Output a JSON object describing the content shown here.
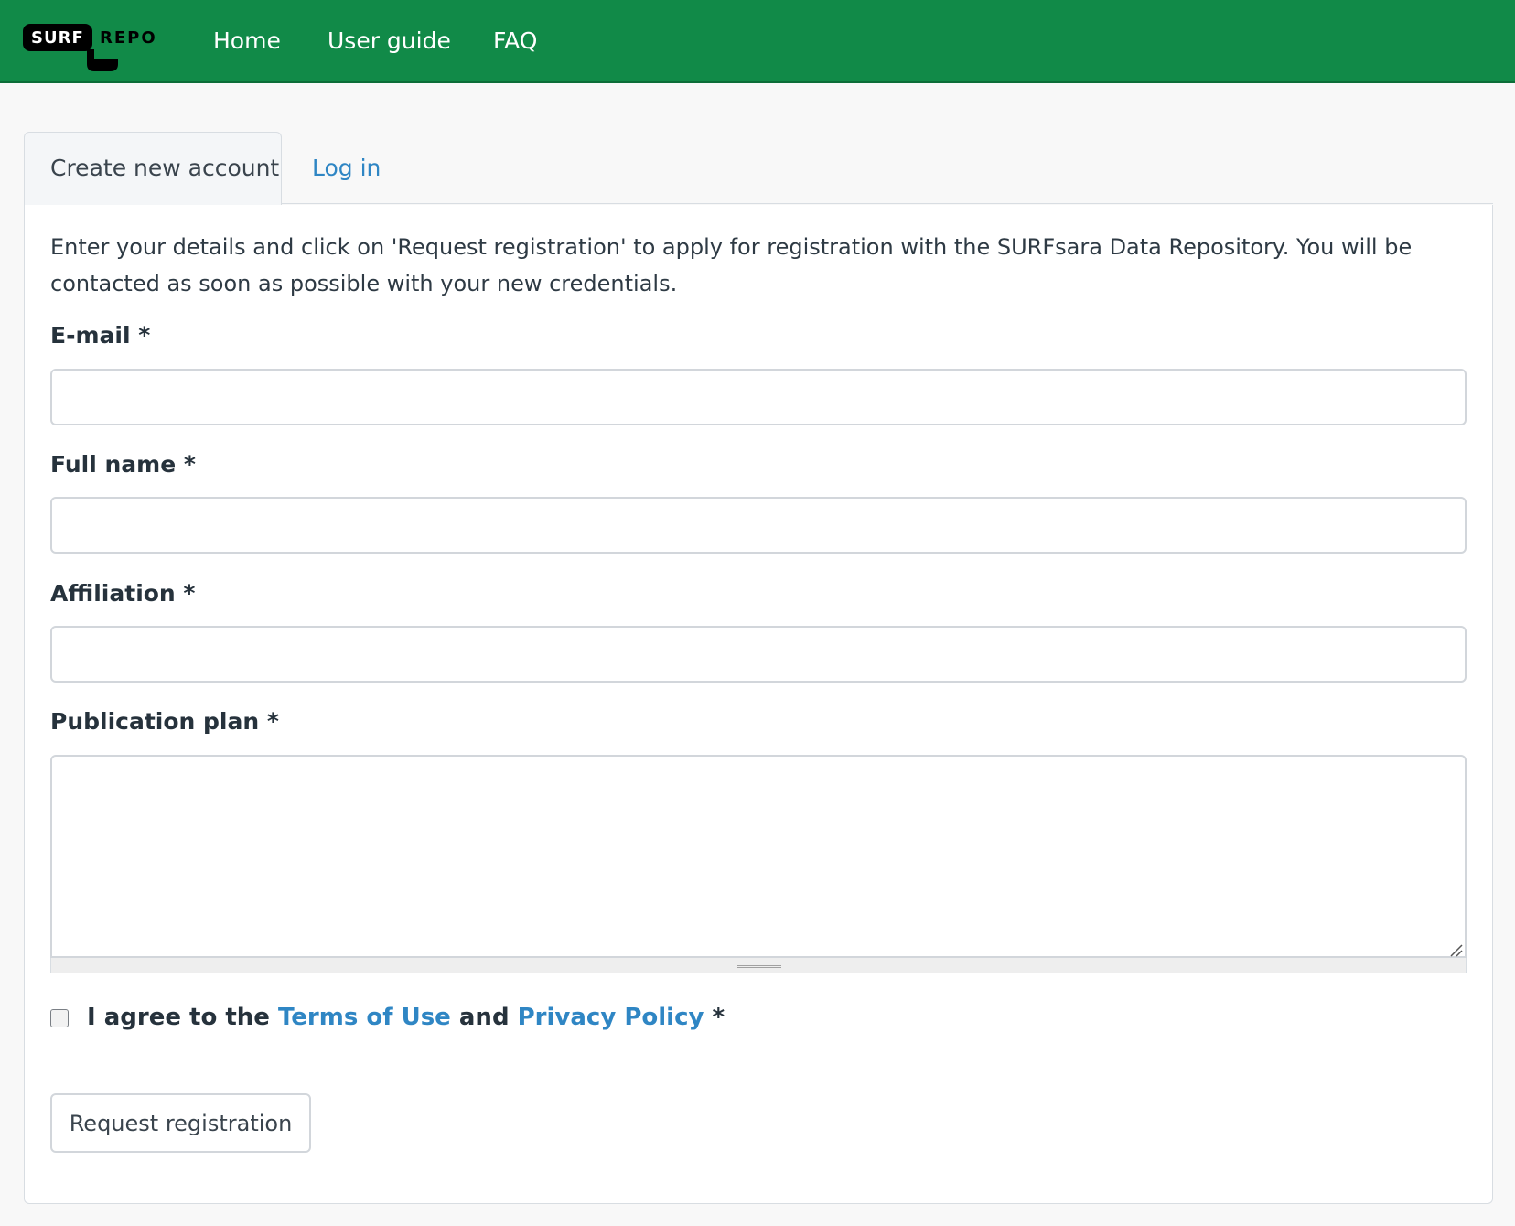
{
  "brand": {
    "logo_text_1": "SURF",
    "logo_text_2": "REPO"
  },
  "nav": {
    "items": [
      {
        "label": "Home"
      },
      {
        "label": "User guide"
      },
      {
        "label": "FAQ"
      }
    ]
  },
  "tabs": [
    {
      "label": "Create new account",
      "active": true
    },
    {
      "label": "Log in",
      "active": false
    }
  ],
  "form": {
    "intro": "Enter your details and click on 'Request registration' to apply for registration with the SURFsara Data Repository. You will be contacted as soon as possible with your new credentials.",
    "fields": [
      {
        "label": "E-mail *",
        "value": ""
      },
      {
        "label": "Full name *",
        "value": ""
      },
      {
        "label": "Affiliation *",
        "value": ""
      },
      {
        "label": "Publication plan *",
        "value": ""
      }
    ],
    "agree": {
      "prefix": "I agree to the",
      "terms": "Terms of Use",
      "middle": "and",
      "privacy": "Privacy Policy",
      "suffix": "*",
      "checked": false
    },
    "submit_label": "Request registration"
  },
  "colors": {
    "navbar": "#118a48",
    "link": "#2f86c4"
  }
}
